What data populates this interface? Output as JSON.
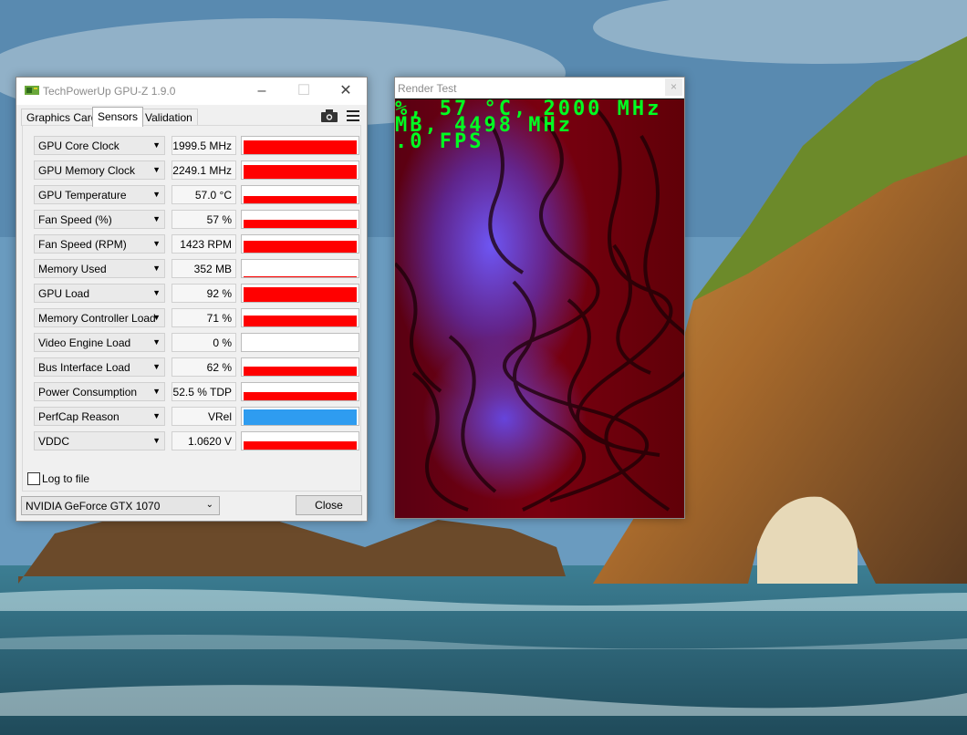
{
  "gpuz": {
    "title": "TechPowerUp GPU-Z 1.9.0",
    "tabs": [
      "Graphics Card",
      "Sensors",
      "Validation"
    ],
    "active_tab": "Sensors",
    "sensors": [
      {
        "label": "GPU Core Clock",
        "value": "1999.5 MHz",
        "level": 0.9
      },
      {
        "label": "GPU Memory Clock",
        "value": "2249.1 MHz",
        "level": 0.9
      },
      {
        "label": "GPU Temperature",
        "value": "57.0 °C",
        "level": 0.45
      },
      {
        "label": "Fan Speed (%)",
        "value": "57 %",
        "level": 0.55
      },
      {
        "label": "Fan Speed (RPM)",
        "value": "1423 RPM",
        "level": 0.75
      },
      {
        "label": "Memory Used",
        "value": "352 MB",
        "level": 0.08
      },
      {
        "label": "GPU Load",
        "value": "92 %",
        "level": 0.92
      },
      {
        "label": "Memory Controller Load",
        "value": "71 %",
        "level": 0.71
      },
      {
        "label": "Video Engine Load",
        "value": "0 %",
        "level": 0.0
      },
      {
        "label": "Bus Interface Load",
        "value": "62 %",
        "level": 0.6
      },
      {
        "label": "Power Consumption",
        "value": "52.5 % TDP",
        "level": 0.55
      },
      {
        "label": "PerfCap Reason",
        "value": "VRel",
        "level": 1.0
      },
      {
        "label": "VDDC",
        "value": "1.0620 V",
        "level": 0.5
      }
    ],
    "log_to_file": "Log to file",
    "gpu_select": "NVIDIA GeForce GTX 1070",
    "close_label": "Close",
    "graph_color": "#ff0000",
    "perfcap_color": "#2e9cf0"
  },
  "render_test": {
    "title": "Render Test",
    "close_glyph": "×",
    "osd_line1": "%, 57 °C, 2000 MHz",
    "osd_line2": " MB, 4498 MHz",
    "osd_line3": ".0 FPS",
    "osd_color": "#00ff22"
  }
}
